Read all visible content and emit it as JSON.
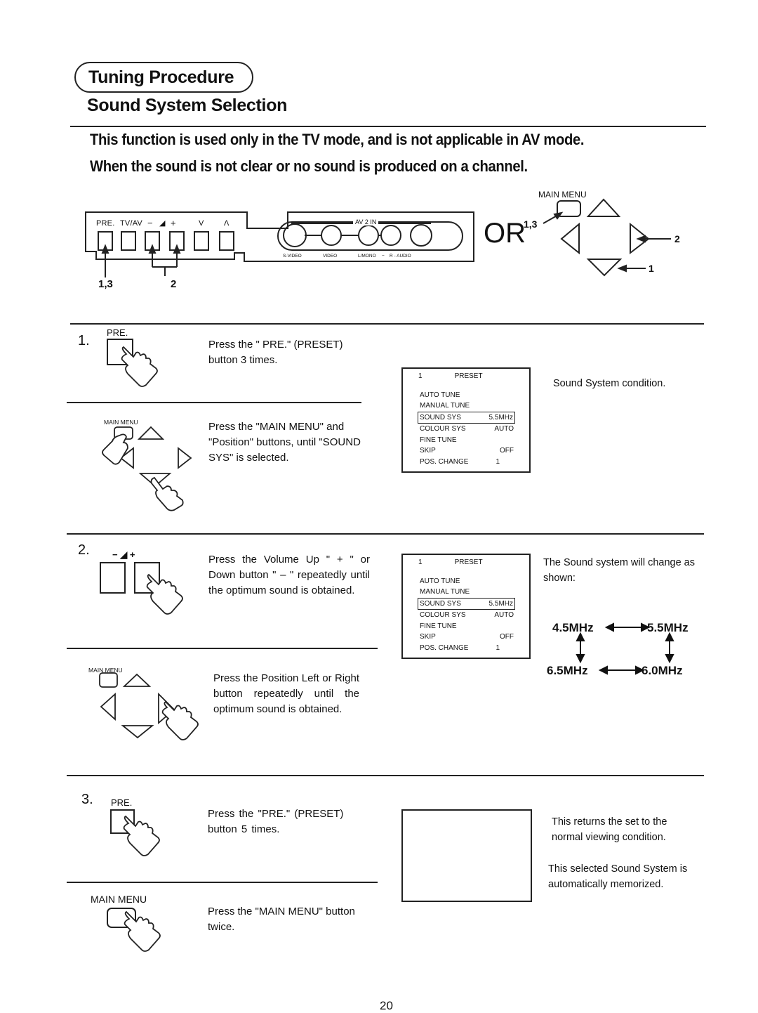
{
  "header": {
    "section_title": "Tuning Procedure",
    "page_title": "Sound System Selection"
  },
  "intro": {
    "line1": "This function is used only in the TV mode, and is not applicable in AV mode.",
    "line2": "When the sound is not clear or no sound is produced on a channel."
  },
  "front_panel": {
    "buttons": [
      "PRE.",
      "TV/AV",
      "−",
      "+",
      "V",
      "Λ"
    ],
    "volume_symbol": "◢",
    "av_label": "AV 2 IN",
    "jacks": [
      "S-VIDEO",
      "VIDEO",
      "L/MONO",
      "−",
      "R - AUDIO"
    ],
    "callouts": [
      "1,3",
      "2"
    ]
  },
  "or_label": "OR",
  "remote": {
    "main_menu_label": "MAIN MENU",
    "callouts": [
      "1,3",
      "2",
      "1"
    ]
  },
  "steps": [
    {
      "number": "1.",
      "icon_label": "PRE.",
      "instruction": "Press the \" PRE.\" (PRESET) button 3 times.",
      "sub_icon_label": "MAIN MENU",
      "sub_instruction": "Press the \"MAIN MENU\" and \"Position\" buttons, until \"SOUND SYS\" is selected.",
      "note": "Sound System condition."
    },
    {
      "number": "2.",
      "icon_label": "− ◢ +",
      "instruction": "Press the Volume Up \" + \" or Down button \" – \" repeatedly until the optimum sound is obtained.",
      "sub_icon_label": "MAIN MENU",
      "sub_instruction": "Press the Position Left or Right button repeatedly until the optimum sound is obtained.",
      "note": "The Sound system will change as shown:"
    },
    {
      "number": "3.",
      "icon_label": "PRE.",
      "instruction": "Press the \"PRE.\" (PRESET) button 5 times.",
      "sub_icon_label": "MAIN MENU",
      "sub_instruction": "Press the \"MAIN MENU\" button twice.",
      "note": "This returns the set to the normal viewing condition.",
      "note2": "This selected Sound System is automatically memorized."
    }
  ],
  "osd_menu": {
    "channel": "1",
    "title": "PRESET",
    "items": [
      {
        "label": "AUTO TUNE",
        "value": ""
      },
      {
        "label": "MANUAL TUNE",
        "value": ""
      },
      {
        "label": "SOUND SYS",
        "value": "5.5MHz",
        "selected": true
      },
      {
        "label": "COLOUR SYS",
        "value": "AUTO"
      },
      {
        "label": "FINE TUNE",
        "value": ""
      },
      {
        "label": "SKIP",
        "value": "OFF"
      },
      {
        "label": "POS. CHANGE",
        "value": "1"
      }
    ]
  },
  "sound_cycle": {
    "top_left": "4.5MHz",
    "top_right": "5.5MHz",
    "bottom_left": "6.5MHz",
    "bottom_right": "6.0MHz"
  },
  "page_number": "20"
}
